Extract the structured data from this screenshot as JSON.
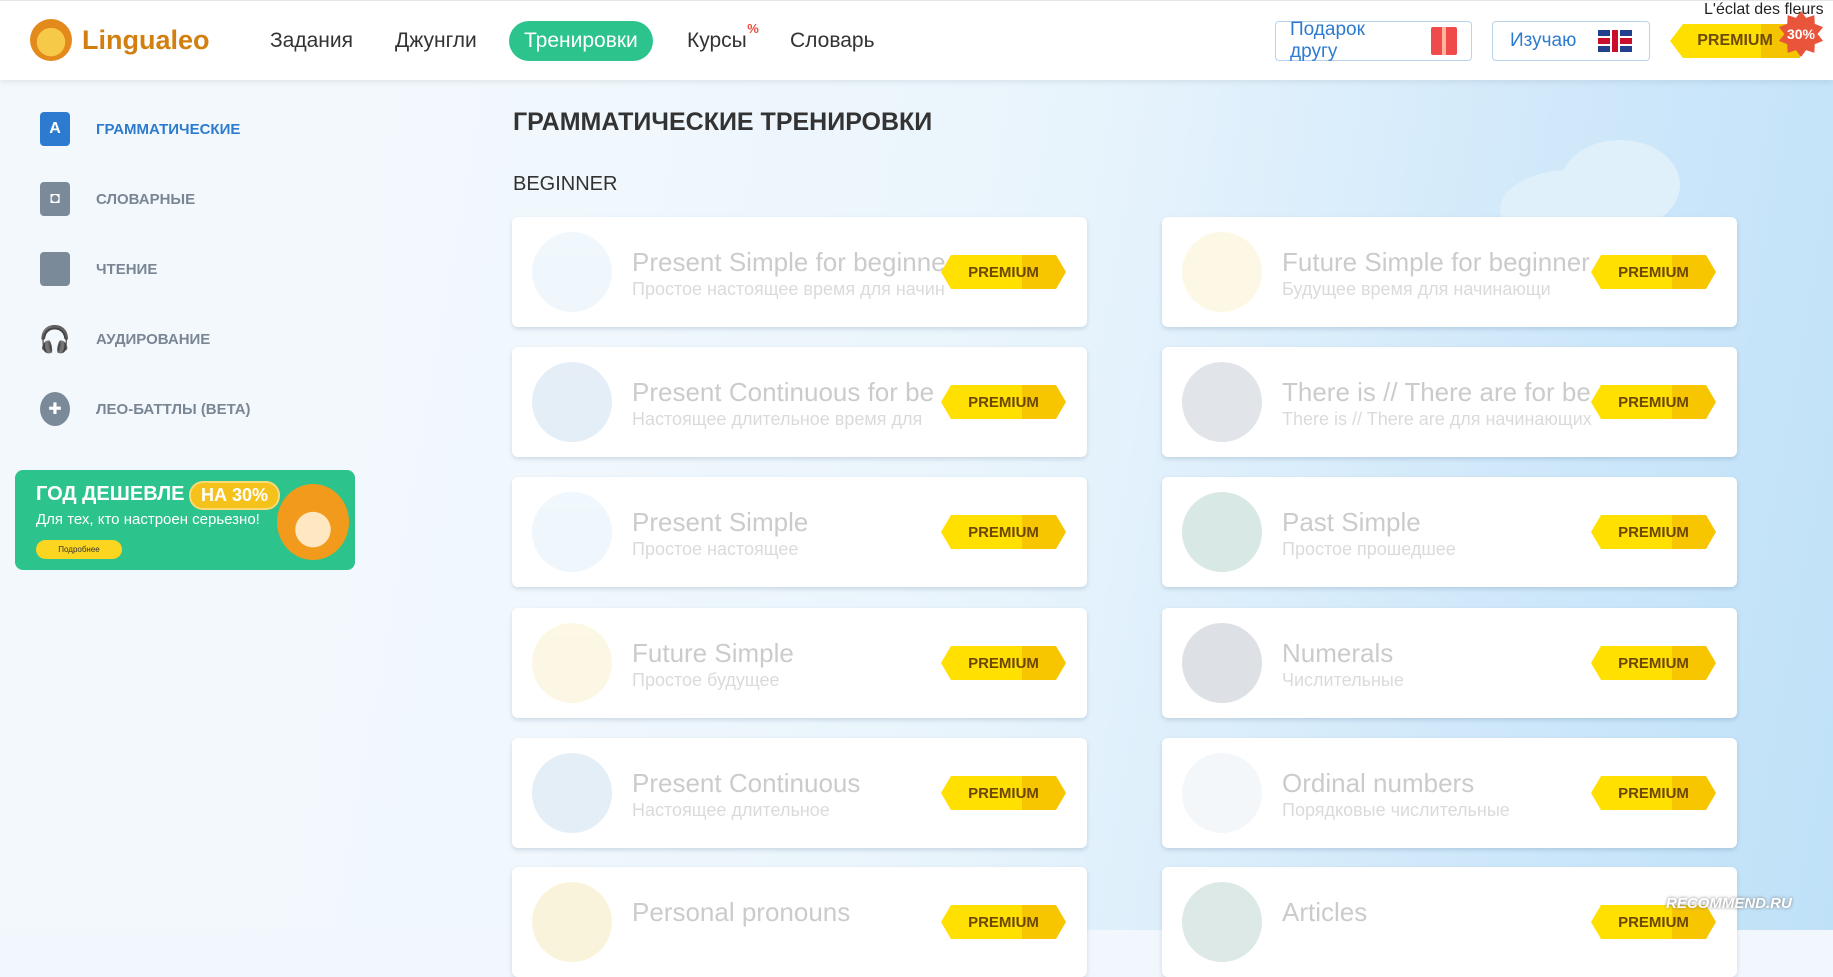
{
  "header": {
    "logo_text": "Lingualeo",
    "nav": [
      {
        "label": "Задания"
      },
      {
        "label": "Джунгли"
      },
      {
        "label": "Тренировки",
        "active": true
      },
      {
        "label": "Курсы",
        "sup": "%"
      },
      {
        "label": "Словарь"
      }
    ],
    "gift_label": "Подарок другу",
    "learning_label": "Изучаю",
    "premium_label": "PREMIUM",
    "discount": "30%",
    "overlay_text": "L'éclat des fleurs"
  },
  "sidebar": {
    "items": [
      {
        "label": "ГРАММАТИЧЕСКИЕ",
        "icon": "A",
        "active": true
      },
      {
        "label": "СЛОВАРНЫЕ",
        "icon": "◘"
      },
      {
        "label": "ЧТЕНИЕ",
        "icon": ""
      },
      {
        "label": "АУДИРОВАНИЕ",
        "icon": "🎧"
      },
      {
        "label": "ЛЕО-БАТТЛЫ (BETA)",
        "icon": "✚"
      }
    ],
    "banner": {
      "title": "ГОД ДЕШЕВЛЕ",
      "badge": "НА 30%",
      "subtitle": "Для тех, кто настроен серьезно!",
      "button": "Подробнее"
    }
  },
  "main": {
    "title": "ГРАММАТИЧЕСКИЕ ТРЕНИРОВКИ",
    "level": "BEGINNER",
    "badge_label": "PREMIUM",
    "cards": [
      {
        "title": "Present Simple for beginne",
        "subtitle": "Простое настоящее время для начин",
        "color": "#cfe8f7"
      },
      {
        "title": "Future Simple for beginner",
        "subtitle": "Будущее время для начинающи",
        "color": "#f8e7a8"
      },
      {
        "title": "Present Continuous for be",
        "subtitle": "Настоящее длительное время для",
        "color": "#a9c8e4"
      },
      {
        "title": "There is // There are for be",
        "subtitle": "There is // There are для начинающих",
        "color": "#9aa9b8"
      },
      {
        "title": "Present Simple",
        "subtitle": "Простое настоящее",
        "color": "#cfe8f7"
      },
      {
        "title": "Past Simple",
        "subtitle": "Простое прошедшее",
        "color": "#7fb7a8"
      },
      {
        "title": "Future Simple",
        "subtitle": "Простое будущее",
        "color": "#f8e7a8"
      },
      {
        "title": "Numerals",
        "subtitle": "Числительные",
        "color": "#8d99a8"
      },
      {
        "title": "Present Continuous",
        "subtitle": "Настоящее длительное",
        "color": "#a9c8e4"
      },
      {
        "title": "Ordinal numbers",
        "subtitle": "Порядковые числительные",
        "color": "#dbe5ee"
      },
      {
        "title": "Personal pronouns",
        "subtitle": "",
        "color": "#f0d88a"
      },
      {
        "title": "Articles",
        "subtitle": "",
        "color": "#8fb5ad"
      }
    ]
  },
  "watermark": "RECOMMEND.RU"
}
